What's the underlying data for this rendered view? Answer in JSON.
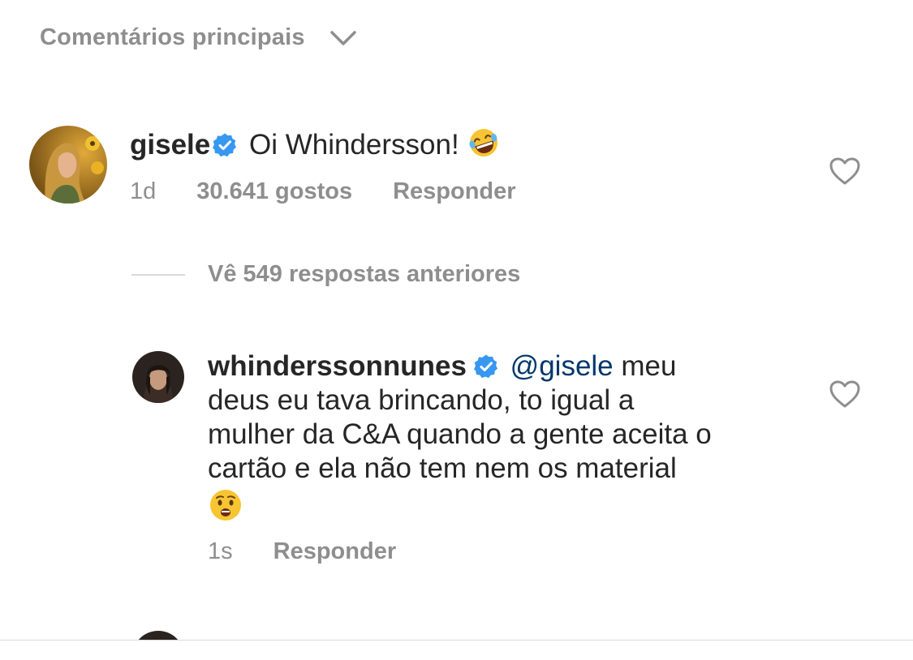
{
  "header": {
    "label": "Comentários principais",
    "icon": "chevron-down-icon"
  },
  "comments": [
    {
      "username": "gisele",
      "verified": true,
      "text": "Oi Whindersson!",
      "emoji": "🤣",
      "time": "1d",
      "likes": "30.641 gostos",
      "reply": "Responder"
    }
  ],
  "view_replies": {
    "label": "Vê 549 respostas anteriores"
  },
  "replies": [
    {
      "username": "whinderssonnunes",
      "verified": true,
      "mention": "@gisele",
      "line1_rest": "meu",
      "line2": "deus eu tava brincando, to igual a",
      "line3": "mulher da C&A quando a gente aceita o",
      "line4": "cartão e ela não tem nem os material",
      "emoji": "😧",
      "time": "1s",
      "reply": "Responder"
    }
  ],
  "colors": {
    "secondary_text": "#8e8e8e",
    "primary_text": "#262626",
    "mention": "#00376b",
    "verified": "#3897f0"
  }
}
